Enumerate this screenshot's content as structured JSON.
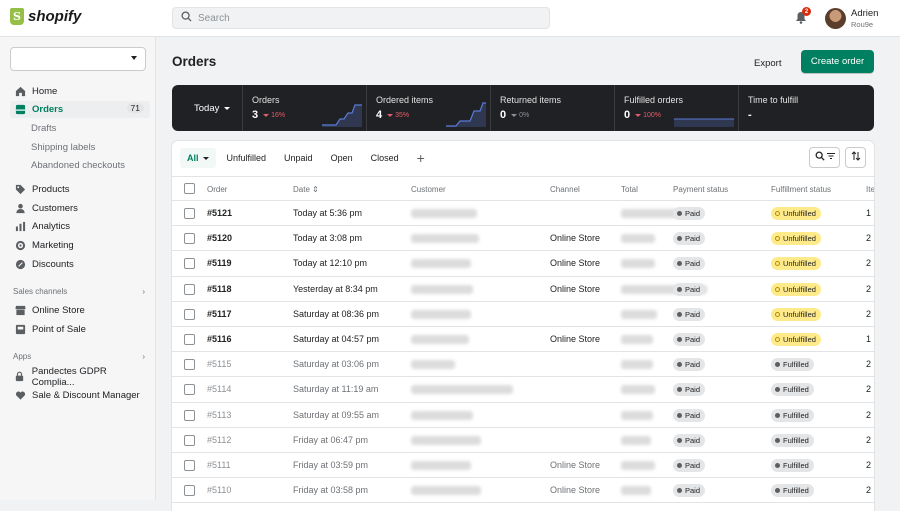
{
  "brand": {
    "name": "shopify",
    "accent": "#008060"
  },
  "search": {
    "placeholder": "Search"
  },
  "notifications": {
    "count": "2"
  },
  "user": {
    "name": "Adrien",
    "sub": "Rou9e"
  },
  "sidebar": {
    "items": [
      {
        "label": "Home",
        "icon": "home-icon"
      },
      {
        "label": "Orders",
        "icon": "orders-icon",
        "count": "71"
      },
      {
        "label": "Drafts"
      },
      {
        "label": "Shipping labels"
      },
      {
        "label": "Abandoned checkouts"
      },
      {
        "label": "Products",
        "icon": "tag-icon"
      },
      {
        "label": "Customers",
        "icon": "person-icon"
      },
      {
        "label": "Analytics",
        "icon": "bar-chart-icon"
      },
      {
        "label": "Marketing",
        "icon": "target-icon"
      },
      {
        "label": "Discounts",
        "icon": "discount-icon"
      }
    ],
    "sales_channels_label": "Sales channels",
    "sales_channels": [
      {
        "label": "Online Store",
        "icon": "store-icon"
      },
      {
        "label": "Point of Sale",
        "icon": "pos-icon"
      }
    ],
    "apps_label": "Apps",
    "apps": [
      {
        "label": "Pandectes GDPR Complia...",
        "icon": "lock-icon"
      },
      {
        "label": "Sale & Discount Manager",
        "icon": "heart-icon"
      }
    ]
  },
  "page": {
    "title": "Orders",
    "export_label": "Export",
    "create_label": "Create order"
  },
  "stats": {
    "period": "Today",
    "items": [
      {
        "label": "Orders",
        "value": "3",
        "delta": "16%",
        "trend": "down"
      },
      {
        "label": "Ordered items",
        "value": "4",
        "delta": "35%",
        "trend": "down"
      },
      {
        "label": "Returned items",
        "value": "0",
        "delta": "0%",
        "trend": "flat"
      },
      {
        "label": "Fulfilled orders",
        "value": "0",
        "delta": "100%",
        "trend": "down"
      },
      {
        "label": "Time to fulfill",
        "value": "-",
        "delta": "",
        "trend": "none"
      }
    ]
  },
  "tabs": [
    {
      "label": "All"
    },
    {
      "label": "Unfulfilled"
    },
    {
      "label": "Unpaid"
    },
    {
      "label": "Open"
    },
    {
      "label": "Closed"
    },
    {
      "label": "+"
    }
  ],
  "table": {
    "headers": {
      "order": "Order",
      "date": "Date",
      "customer": "Customer",
      "channel": "Channel",
      "total": "Total",
      "payment": "Payment status",
      "fulfillment": "Fulfillment status",
      "items": "Ite"
    },
    "rows": [
      {
        "order": "#5121",
        "date": "Today at 5:36 pm",
        "channel": "",
        "payment": "Paid",
        "fulfillment": "Unfulfilled",
        "items": "1"
      },
      {
        "order": "#5120",
        "date": "Today at 3:08 pm",
        "channel": "Online Store",
        "payment": "Paid",
        "fulfillment": "Unfulfilled",
        "items": "2"
      },
      {
        "order": "#5119",
        "date": "Today at 12:10 pm",
        "channel": "Online Store",
        "payment": "Paid",
        "fulfillment": "Unfulfilled",
        "items": "2"
      },
      {
        "order": "#5118",
        "date": "Yesterday at 8:34 pm",
        "channel": "Online Store",
        "payment": "Paid",
        "fulfillment": "Unfulfilled",
        "items": "2"
      },
      {
        "order": "#5117",
        "date": "Saturday at 08:36 pm",
        "channel": "",
        "payment": "Paid",
        "fulfillment": "Unfulfilled",
        "items": "2"
      },
      {
        "order": "#5116",
        "date": "Saturday at 04:57 pm",
        "channel": "Online Store",
        "payment": "Paid",
        "fulfillment": "Unfulfilled",
        "items": "1"
      },
      {
        "order": "#5115",
        "date": "Saturday at 03:06 pm",
        "channel": "",
        "payment": "Paid",
        "fulfillment": "Fulfilled",
        "items": "2"
      },
      {
        "order": "#5114",
        "date": "Saturday at 11:19 am",
        "channel": "",
        "payment": "Paid",
        "fulfillment": "Fulfilled",
        "items": "2"
      },
      {
        "order": "#5113",
        "date": "Saturday at 09:55 am",
        "channel": "",
        "payment": "Paid",
        "fulfillment": "Fulfilled",
        "items": "2"
      },
      {
        "order": "#5112",
        "date": "Friday at 06:47 pm",
        "channel": "",
        "payment": "Paid",
        "fulfillment": "Fulfilled",
        "items": "2"
      },
      {
        "order": "#5111",
        "date": "Friday at 03:59 pm",
        "channel": "Online Store",
        "payment": "Paid",
        "fulfillment": "Fulfilled",
        "items": "2"
      },
      {
        "order": "#5110",
        "date": "Friday at 03:58 pm",
        "channel": "Online Store",
        "payment": "Paid",
        "fulfillment": "Fulfilled",
        "items": "2"
      }
    ]
  }
}
